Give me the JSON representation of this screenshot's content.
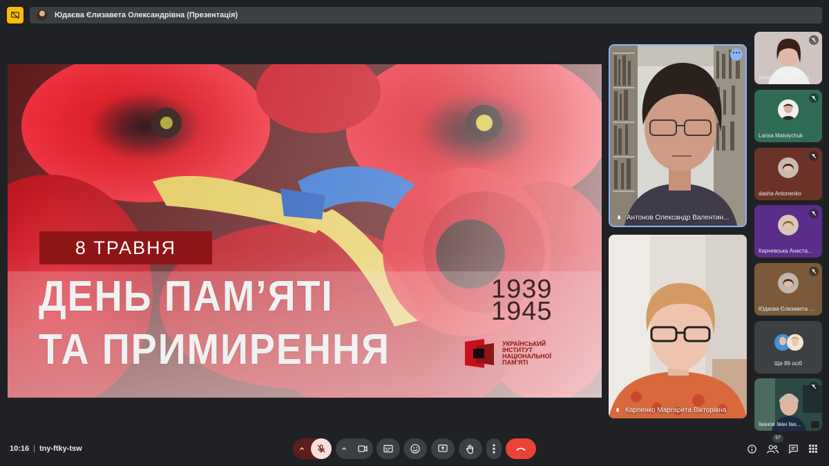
{
  "topbar": {
    "presenter_text": "Юдаєва Єлизавета Олександрівна (Презентація)"
  },
  "slide": {
    "date": "8 ТРАВНЯ",
    "title_line1": "ДЕНЬ ПАМ’ЯТІ",
    "title_line2": "ТА ПРИМИРЕННЯ",
    "year_start": "1939",
    "year_end": "1945",
    "institute": [
      "УКРАЇНСЬКИЙ",
      "ІНСТИТУТ",
      "НАЦІОНАЛЬНОЇ",
      "ПАМ’ЯТІ"
    ]
  },
  "participants_main": [
    {
      "name": "Антонов Олександр Валентин..."
    },
    {
      "name": "Карпенко Маргарита Вікторівна"
    }
  ],
  "participants_side": [
    {
      "name": "Некрасова Ярослав...",
      "muted": true
    },
    {
      "name": "Larisa Matviychuk",
      "muted": true
    },
    {
      "name": "dasha Antonenko",
      "muted": true
    },
    {
      "name": "Карчевська Анаста...",
      "muted": true
    },
    {
      "name": "Юдаєва Єлизавета ...",
      "muted": true
    },
    {
      "name": "Ще 89 осіб",
      "muted": false
    },
    {
      "name": "Іванов Іван Іва...",
      "muted": true
    }
  ],
  "bottombar": {
    "time": "10:16",
    "meeting_code": "tny-ftky-tsw",
    "participant_count": "97"
  },
  "colors": {
    "background": "#202124",
    "accent_blue": "#8ab4f8",
    "end_call_red": "#ea4335",
    "presenting_yellow": "#fbbc04",
    "mic_off_pink": "#f9dedc"
  }
}
